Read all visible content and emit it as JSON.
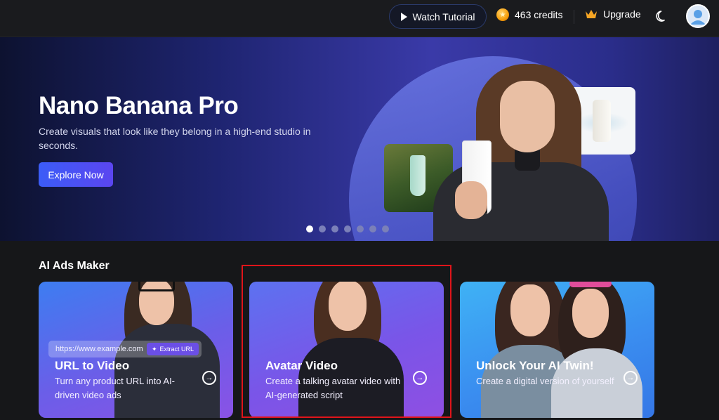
{
  "topbar": {
    "watch_tutorial": "Watch Tutorial",
    "credits": "463 credits",
    "upgrade": "Upgrade",
    "icons": [
      "play-icon",
      "coin-icon",
      "crown-icon",
      "moon-icon",
      "user-avatar"
    ]
  },
  "hero": {
    "title": "Nano Banana Pro",
    "subtitle": "Create visuals that look like they belong in a high-end studio in seconds.",
    "cta": "Explore Now",
    "slides_count": 7,
    "active_slide": 1
  },
  "section": {
    "title": "AI Ads Maker"
  },
  "tiles": [
    {
      "title": "URL to Video",
      "desc": "Turn any product URL into AI-driven video ads",
      "url_placeholder": "https://www.example.com",
      "extract_label": "Extract URL"
    },
    {
      "title": "Avatar Video",
      "desc": "Create a talking avatar video with AI-generated script"
    },
    {
      "title": "Unlock Your AI Twin!",
      "desc": "Create a digital version of yourself"
    }
  ],
  "colors": {
    "accent": "#4f5cf3",
    "highlight_box": "#e0141a",
    "background": "#161719"
  }
}
